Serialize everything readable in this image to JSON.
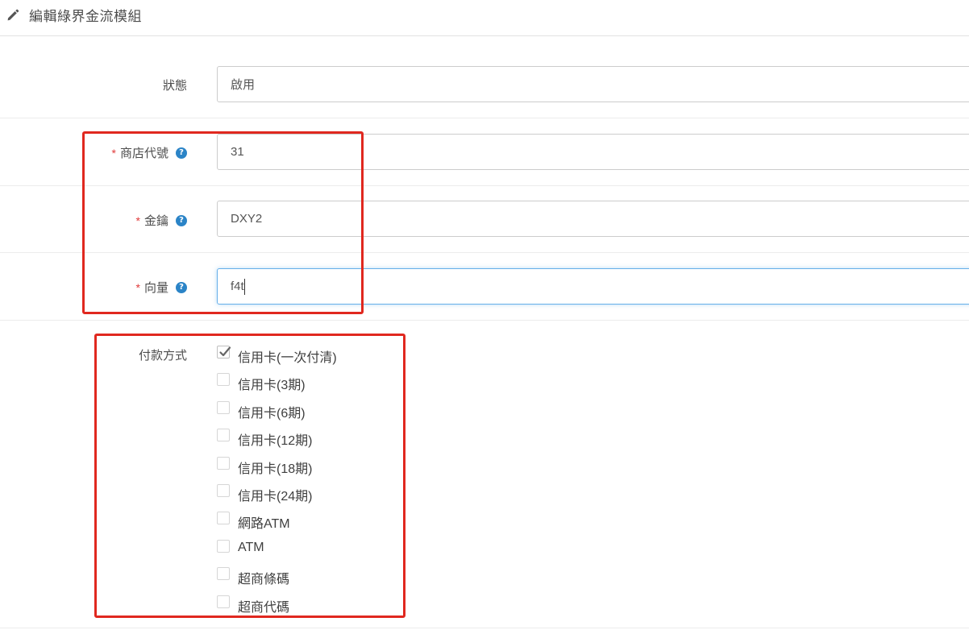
{
  "header": {
    "title": "編輯綠界金流模組"
  },
  "form": {
    "status": {
      "label": "狀態",
      "value": "啟用"
    },
    "merchant_id": {
      "label": "商店代號",
      "value": "31",
      "required": "*"
    },
    "hash_key": {
      "label": "金鑰",
      "value": "DXY2",
      "required": "*"
    },
    "hash_iv": {
      "label": "向量",
      "value": "f4t",
      "required": "*"
    },
    "payment": {
      "label": "付款方式",
      "options": [
        {
          "label": "信用卡(一次付清)",
          "checked": true
        },
        {
          "label": "信用卡(3期)",
          "checked": false
        },
        {
          "label": "信用卡(6期)",
          "checked": false
        },
        {
          "label": "信用卡(12期)",
          "checked": false
        },
        {
          "label": "信用卡(18期)",
          "checked": false
        },
        {
          "label": "信用卡(24期)",
          "checked": false
        },
        {
          "label": "網路ATM",
          "checked": false
        },
        {
          "label": "ATM",
          "checked": false
        },
        {
          "label": "超商條碼",
          "checked": false
        },
        {
          "label": "超商代碼",
          "checked": false
        }
      ]
    }
  },
  "colors": {
    "highlight": "#e0281f",
    "help_icon": "#2b84c7",
    "required": "#e03a3a",
    "focus_border": "#66afe9"
  },
  "icons": {
    "header": "pencil-icon",
    "help": "question-circle-icon",
    "check": "checkmark-icon"
  },
  "help_glyph": "?"
}
